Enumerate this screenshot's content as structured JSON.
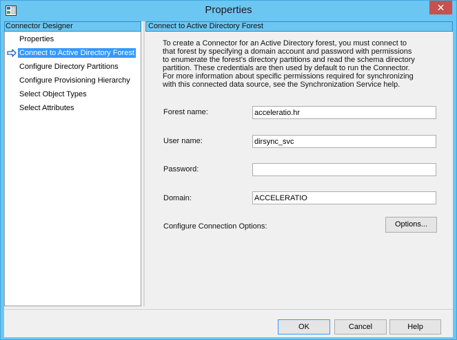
{
  "window": {
    "title": "Properties",
    "close_glyph": "✕",
    "colors": {
      "titlebar": "#6cc6f2",
      "close": "#c75050",
      "selection": "#3399ff"
    }
  },
  "left_panel": {
    "header": "Connector Designer",
    "items": [
      {
        "label": "Properties",
        "active": false
      },
      {
        "label": "Connect to Active Directory Forest",
        "active": true,
        "icon": "arrow-right-icon"
      },
      {
        "label": "Configure Directory Partitions",
        "active": false
      },
      {
        "label": "Configure Provisioning Hierarchy",
        "active": false
      },
      {
        "label": "Select Object Types",
        "active": false
      },
      {
        "label": "Select Attributes",
        "active": false
      }
    ]
  },
  "right_panel": {
    "header": "Connect to Active Directory Forest",
    "description": "To create a Connector for an Active Directory forest, you must connect to that forest by specifying a domain account and password with permissions to enumerate the forest's directory partitions and read the schema directory partition. These credentials are then used by default to run the Connector. For more information about specific permissions required for synchronizing with this connected data source, see the Synchronization Service help.",
    "fields": {
      "forest_name": {
        "label": "Forest name:",
        "value": "acceleratio.hr"
      },
      "user_name": {
        "label": "User name:",
        "value": "dirsync_svc"
      },
      "password": {
        "label": "Password:",
        "value": ""
      },
      "domain": {
        "label": "Domain:",
        "value": "ACCELERATIO"
      }
    },
    "connection_options": {
      "label": "Configure Connection Options:",
      "button": "Options..."
    }
  },
  "footer": {
    "ok": "OK",
    "cancel": "Cancel",
    "help": "Help"
  }
}
